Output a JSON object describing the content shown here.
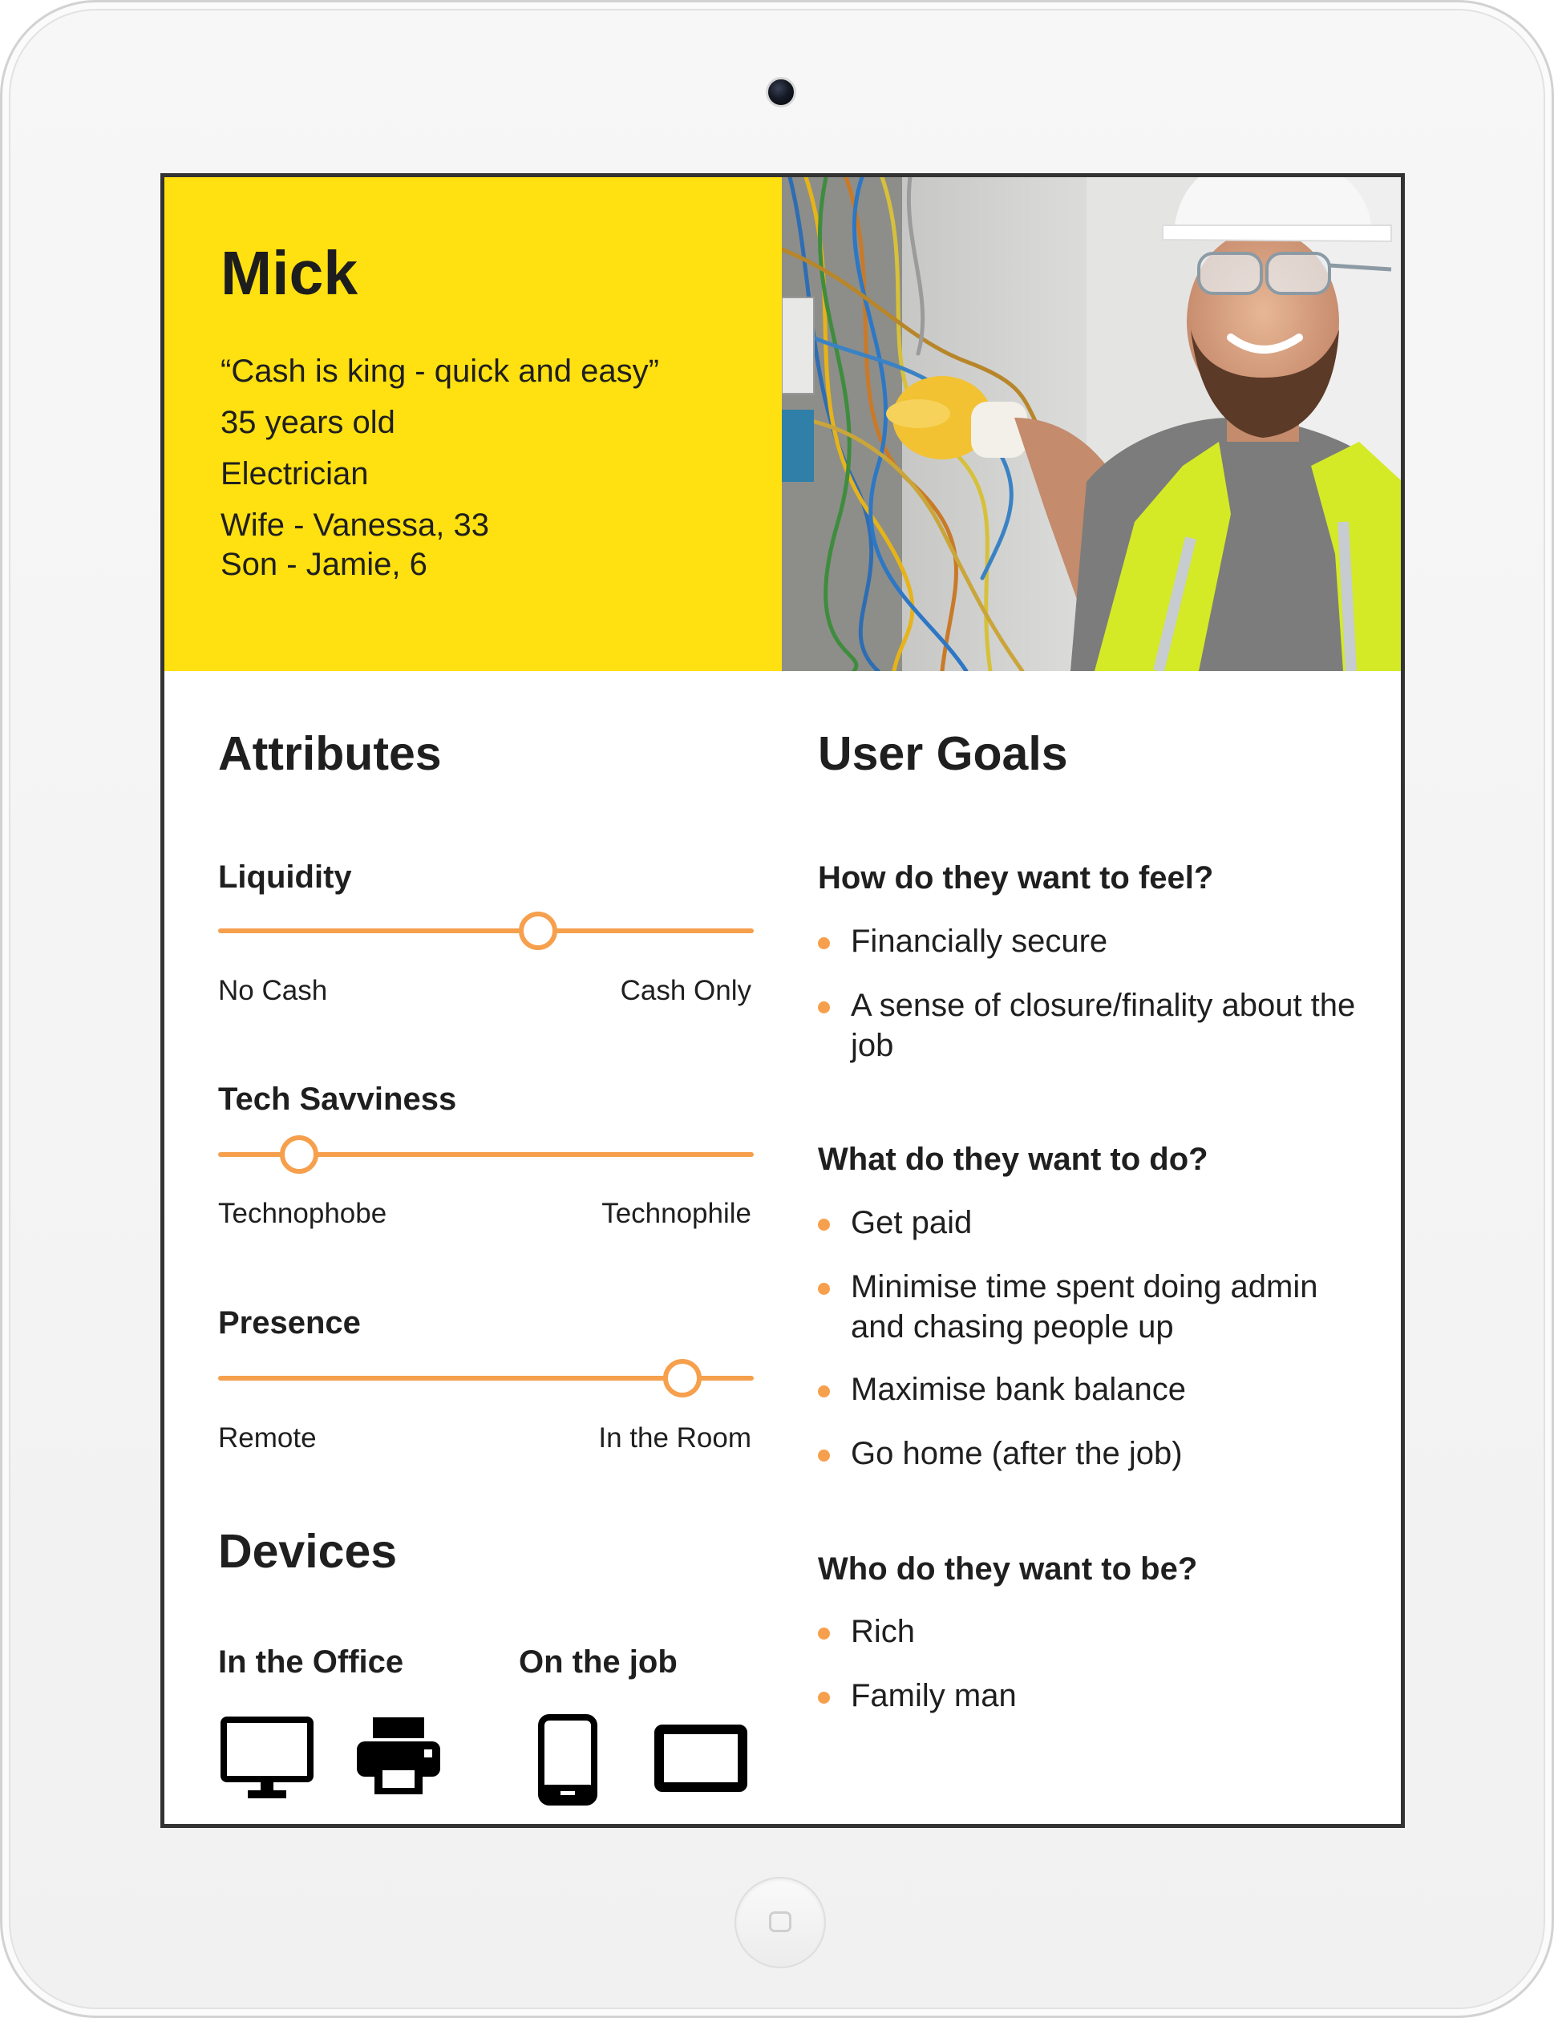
{
  "persona": {
    "name": "Mick",
    "quote": "“Cash is king - quick and easy”",
    "age": "35 years old",
    "job": "Electrician",
    "family": [
      "Wife - Vanessa, 33",
      "Son - Jamie, 6"
    ],
    "photo_icon": "electrician-photo"
  },
  "attributes": {
    "title": "Attributes",
    "items": [
      {
        "label": "Liquidity",
        "left": "No Cash",
        "right": "Cash Only",
        "level": 0.6
      },
      {
        "label": "Tech Savviness",
        "left": "Technophobe",
        "right": "Technophile",
        "level": 0.15
      },
      {
        "label": "Presence",
        "left": "Remote",
        "right": "In the Room",
        "level": 0.87
      }
    ]
  },
  "devices": {
    "title": "Devices",
    "groups": [
      {
        "label": "In the Office",
        "icons": [
          "desktop-monitor-icon",
          "printer-icon"
        ]
      },
      {
        "label": "On the job",
        "icons": [
          "smartphone-icon",
          "tablet-icon"
        ]
      }
    ]
  },
  "goals": {
    "title": "User Goals",
    "sections": [
      {
        "question": "How do they want to feel?",
        "items": [
          "Financially secure",
          "A sense of closure/finality about the job"
        ]
      },
      {
        "question": "What do they want to do?",
        "items": [
          "Get paid",
          "Minimise time spent doing admin and chasing people up",
          "Maximise bank balance",
          "Go home (after the job)"
        ]
      },
      {
        "question": "Who do they want to be?",
        "items": [
          "Rich",
          "Family man"
        ]
      }
    ]
  },
  "colors": {
    "accent": "#f6a04d",
    "header": "#ffe010",
    "text": "#1f1f1f",
    "frame": "#333333"
  }
}
